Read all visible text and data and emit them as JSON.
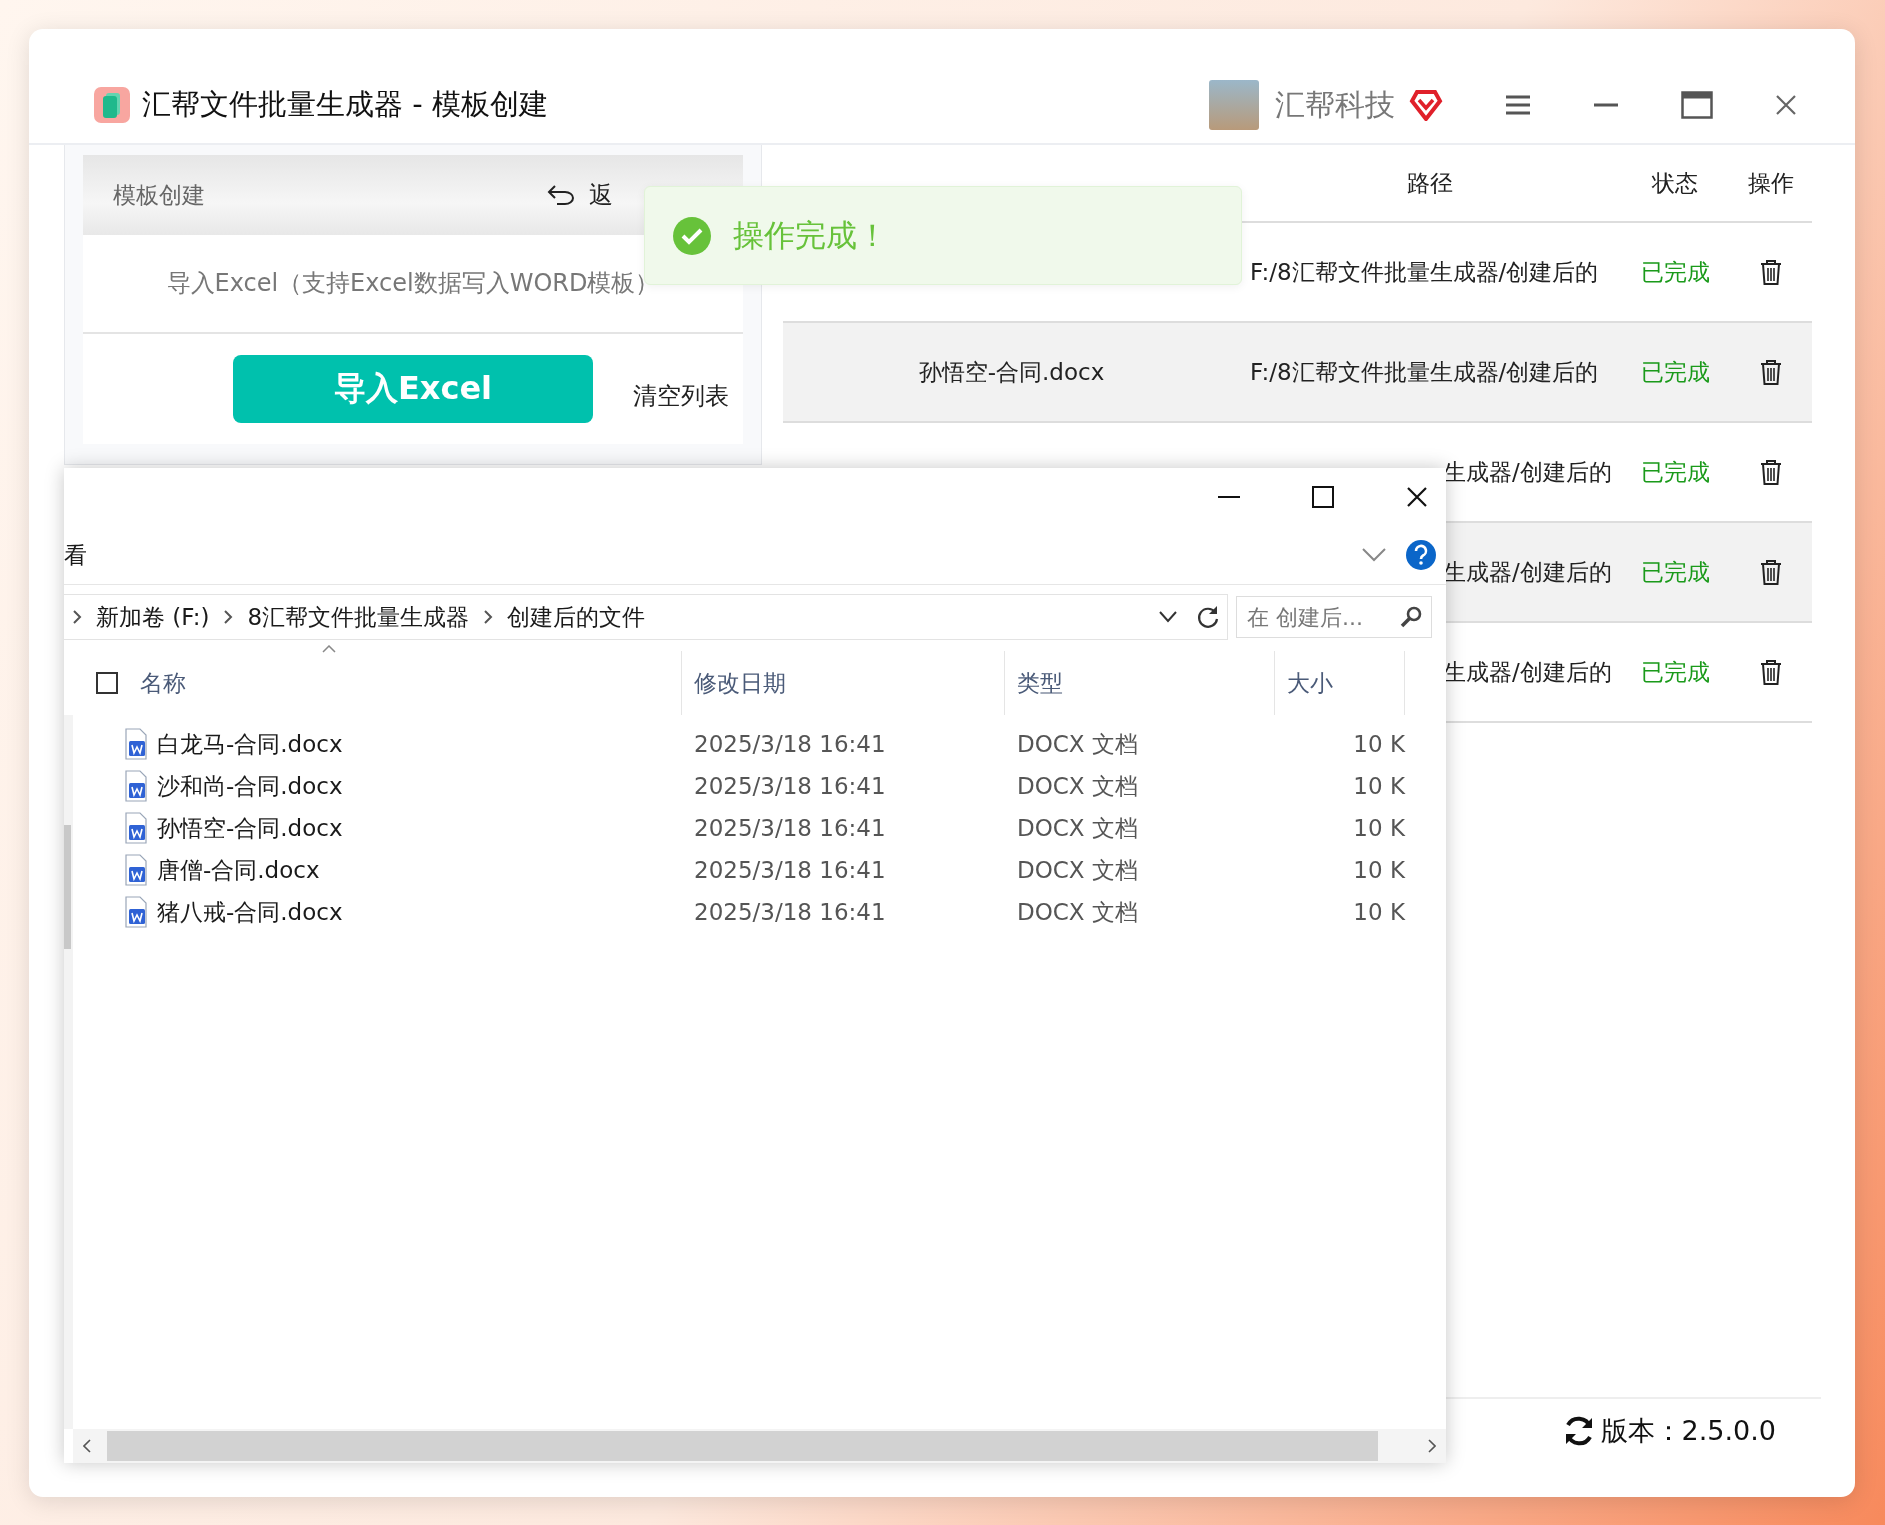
{
  "window": {
    "title": "汇帮文件批量生成器 - 模板创建",
    "account_name": "汇帮科技"
  },
  "left_panel": {
    "header_title": "模板创建",
    "back_label": "返",
    "import_hint": "导入Excel（支持Excel数据写入WORD模板）",
    "import_button": "导入Excel",
    "clear_button": "清空列表"
  },
  "table": {
    "columns": [
      "路径",
      "状态",
      "操作"
    ],
    "rows": [
      {
        "path": "F:/8汇帮文件批量生成器/创建后的",
        "status": "已完成"
      },
      {
        "name": "孙悟空-合同.docx",
        "path": "F:/8汇帮文件批量生成器/创建后的",
        "status": "已完成"
      },
      {
        "path": "生成器/创建后的",
        "status": "已完成"
      },
      {
        "path": "生成器/创建后的",
        "status": "已完成"
      },
      {
        "path": "生成器/创建后的",
        "status": "已完成"
      }
    ]
  },
  "toast": {
    "message": "操作完成！"
  },
  "footer": {
    "version": "版本：2.5.0.0"
  },
  "explorer": {
    "ribbon_tab": "看",
    "breadcrumb": [
      "新加卷 (F:)",
      "8汇帮文件批量生成器",
      "创建后的文件"
    ],
    "search_placeholder": "在 创建后...",
    "select_all_checked": false,
    "columns": [
      "名称",
      "修改日期",
      "类型",
      "大小"
    ],
    "files": [
      {
        "name": "白龙马-合同.docx",
        "modified": "2025/3/18 16:41",
        "type": "DOCX 文档",
        "size": "10 K"
      },
      {
        "name": "沙和尚-合同.docx",
        "modified": "2025/3/18 16:41",
        "type": "DOCX 文档",
        "size": "10 K"
      },
      {
        "name": "孙悟空-合同.docx",
        "modified": "2025/3/18 16:41",
        "type": "DOCX 文档",
        "size": "10 K"
      },
      {
        "name": "唐僧-合同.docx",
        "modified": "2025/3/18 16:41",
        "type": "DOCX 文档",
        "size": "10 K"
      },
      {
        "name": "猪八戒-合同.docx",
        "modified": "2025/3/18 16:41",
        "type": "DOCX 文档",
        "size": "10 K"
      }
    ]
  }
}
